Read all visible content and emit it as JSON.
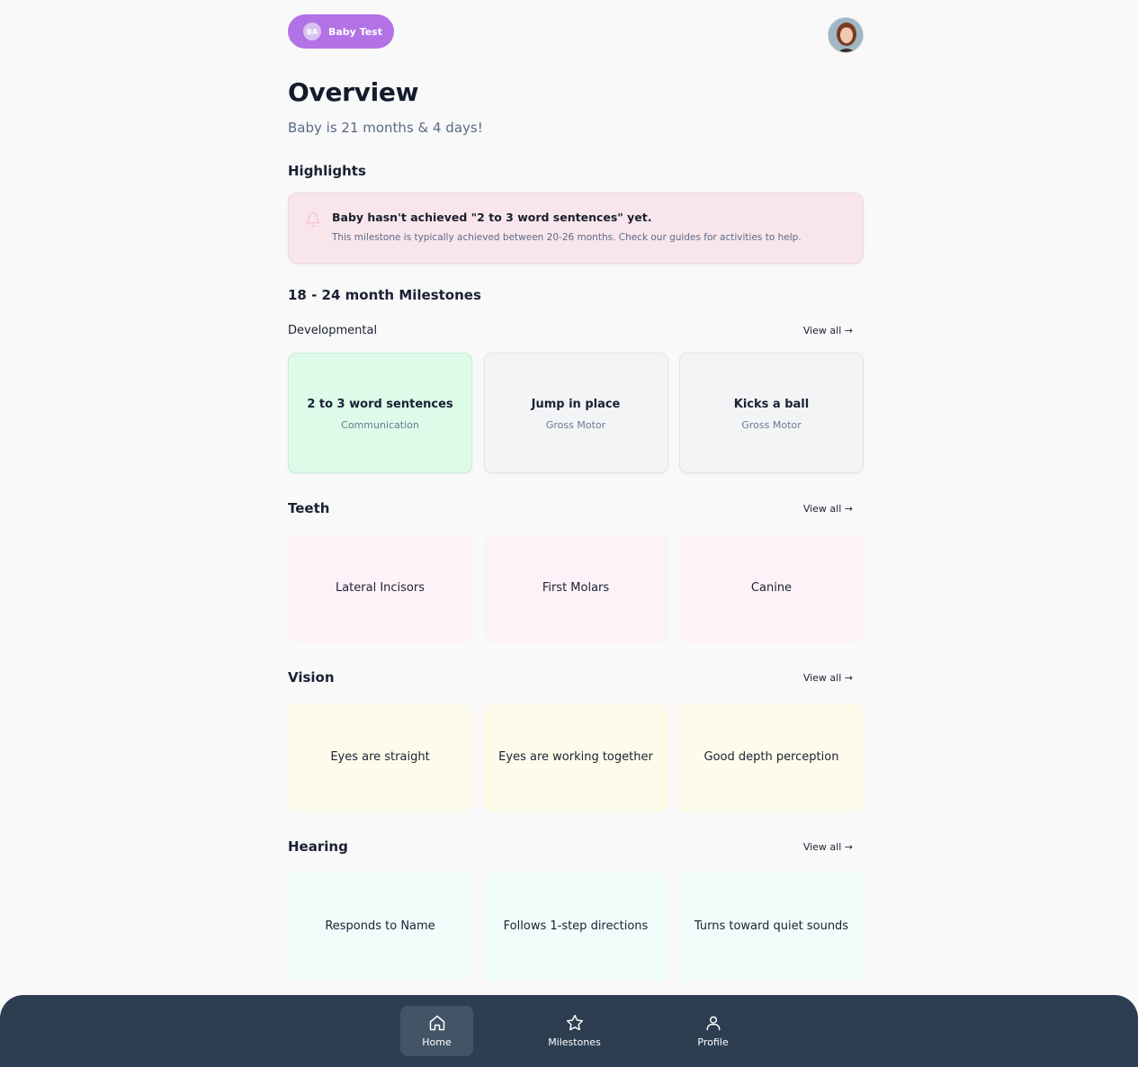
{
  "header": {
    "baby_initials": "BA",
    "baby_name": "Baby Test",
    "user_avatar_icon": "user-photo"
  },
  "page": {
    "title": "Overview",
    "age_line": "Baby is 21 months & 4 days!"
  },
  "highlights": {
    "heading": "Highlights",
    "alert_title": "Baby hasn't achieved \"2 to 3 word sentences\" yet.",
    "alert_text": "This milestone is typically achieved between 20-26 months. Check our guides for activities to help.",
    "icon": "bell-icon"
  },
  "milestones_heading": "18 - 24 month Milestones",
  "view_all_label": "View all →",
  "developmental": {
    "title": "Developmental",
    "cards": [
      {
        "title": "2 to 3 word sentences",
        "category": "Communication"
      },
      {
        "title": "Jump in place",
        "category": "Gross Motor"
      },
      {
        "title": "Kicks a ball",
        "category": "Gross Motor"
      }
    ]
  },
  "teeth": {
    "title": "Teeth",
    "cards": [
      {
        "title": "Lateral Incisors"
      },
      {
        "title": "First Molars"
      },
      {
        "title": "Canine"
      }
    ]
  },
  "vision": {
    "title": "Vision",
    "cards": [
      {
        "title": "Eyes are straight"
      },
      {
        "title": "Eyes are working together"
      },
      {
        "title": "Good depth perception"
      }
    ]
  },
  "hearing": {
    "title": "Hearing",
    "cards": [
      {
        "title": "Responds to Name"
      },
      {
        "title": "Follows 1-step directions"
      },
      {
        "title": "Turns toward quiet sounds"
      }
    ]
  },
  "nav": {
    "items": [
      {
        "label": "Home",
        "icon": "home-icon",
        "active": true
      },
      {
        "label": "Milestones",
        "icon": "star-icon",
        "active": false
      },
      {
        "label": "Profile",
        "icon": "user-icon",
        "active": false
      }
    ]
  },
  "colors": {
    "accent_purple": "#b272e6",
    "nav_bg": "#2d3e51",
    "alert_bg": "#f8e6ec",
    "achieved_bg": "#dcfbe8"
  }
}
